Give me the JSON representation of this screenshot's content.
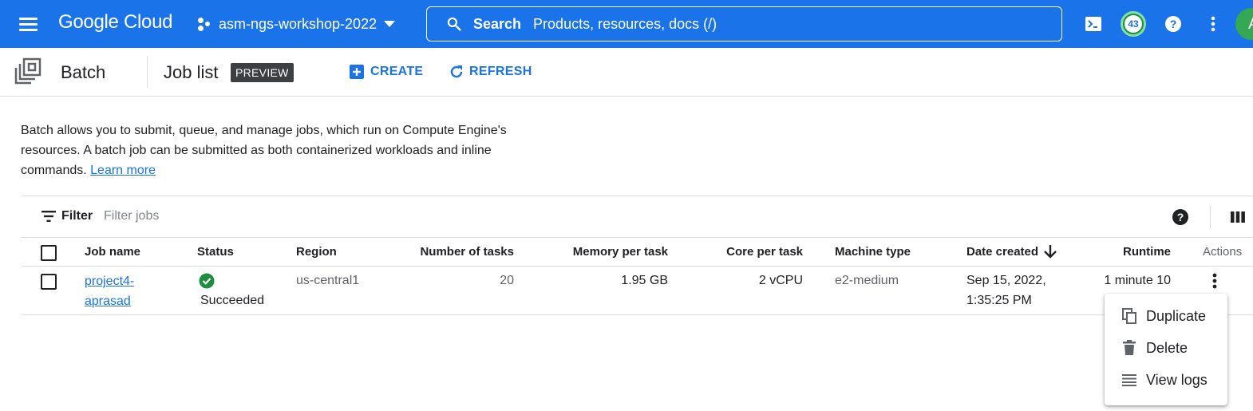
{
  "topbar": {
    "logo": "Google Cloud",
    "project": "asm-ngs-workshop-2022",
    "search_label": "Search",
    "search_placeholder": "Products, resources, docs (/)",
    "notification_count": "43",
    "avatar_initial": "A"
  },
  "subheader": {
    "product": "Batch",
    "page_title": "Job list",
    "badge": "PREVIEW",
    "create_label": "CREATE",
    "refresh_label": "REFRESH"
  },
  "description": {
    "text": "Batch allows you to submit, queue, and manage jobs, which run on Compute Engine's resources. A batch job can be submitted as both containerized workloads and inline commands.",
    "learn_more": "Learn more"
  },
  "filter": {
    "label": "Filter",
    "placeholder": "Filter jobs"
  },
  "table": {
    "headers": {
      "job_name": "Job name",
      "status": "Status",
      "region": "Region",
      "tasks": "Number of tasks",
      "memory": "Memory per task",
      "core": "Core per task",
      "machine": "Machine type",
      "date": "Date created",
      "runtime": "Runtime",
      "actions": "Actions"
    },
    "rows": [
      {
        "job_name_l1": "project4-",
        "job_name_l2": "aprasad",
        "status": "Succeeded",
        "region": "us-central1",
        "tasks": "20",
        "memory": "1.95 GB",
        "core": "2 vCPU",
        "machine": "e2-medium",
        "date_l1": "Sep 15, 2022,",
        "date_l2": "1:35:25 PM",
        "runtime": "1 minute 10"
      }
    ]
  },
  "context_menu": {
    "items": [
      "Duplicate",
      "Delete",
      "View logs"
    ]
  },
  "colors": {
    "brand_blue": "#1a73e8",
    "success_green": "#1e8e3e",
    "preview_badge": "#3c4043"
  },
  "icons": [
    "menu-icon",
    "project-icon",
    "search-icon",
    "cloud-shell-icon",
    "help-icon",
    "more-vert-icon",
    "batch-icon",
    "add-icon",
    "refresh-icon",
    "filter-icon",
    "columns-icon",
    "check-circle-icon",
    "arrow-down-icon",
    "copy-icon",
    "trash-icon",
    "list-icon"
  ]
}
